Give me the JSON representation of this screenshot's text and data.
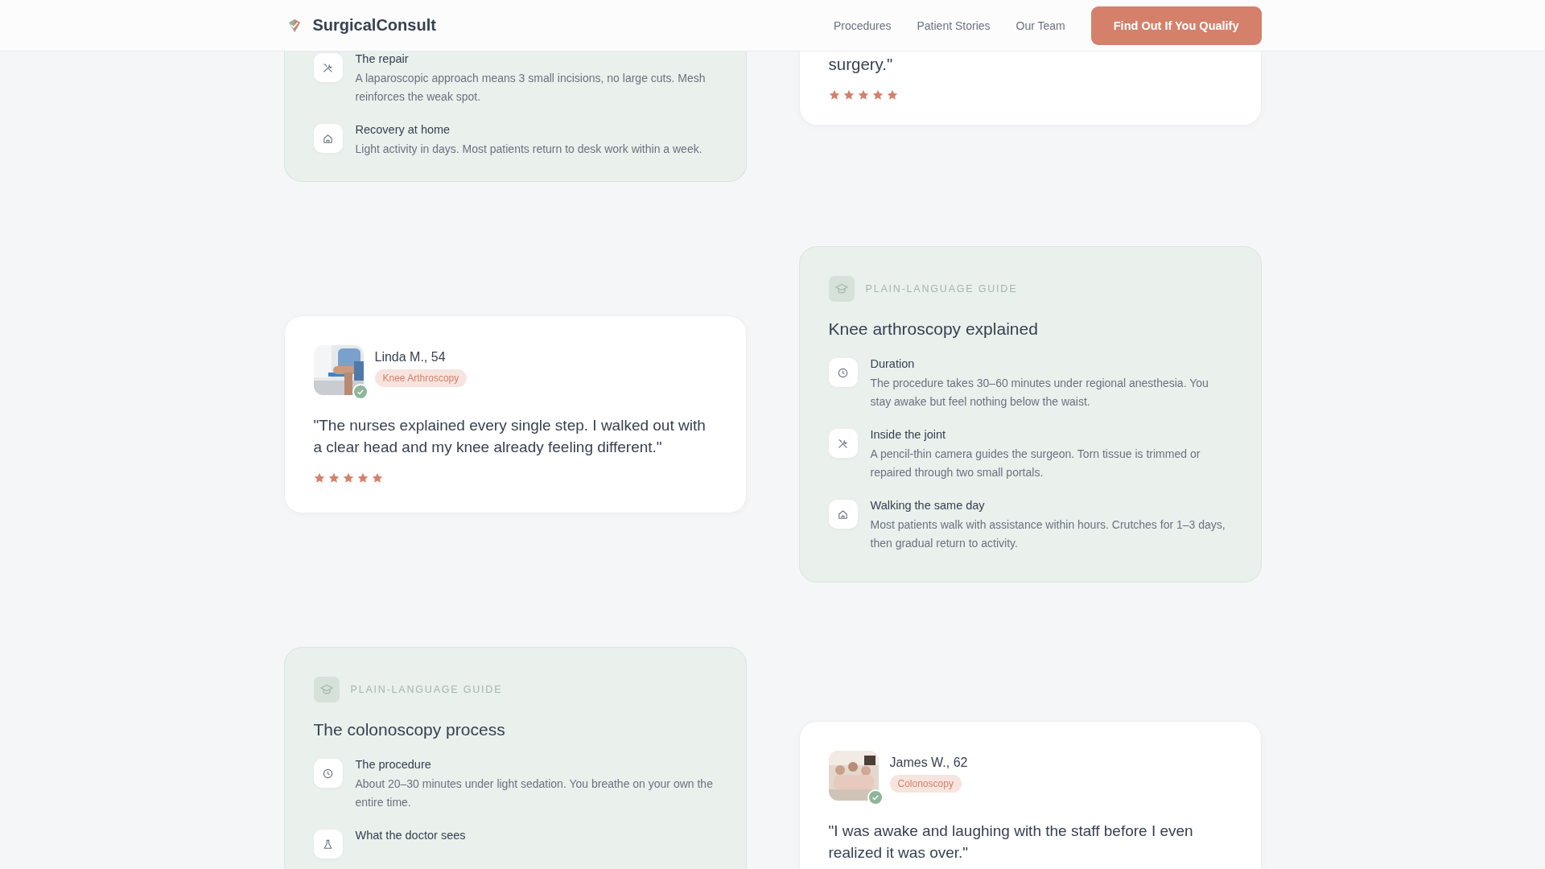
{
  "header": {
    "brand": "SurgicalConsult",
    "nav": [
      "Procedures",
      "Patient Stories",
      "Our Team"
    ],
    "cta": "Find Out If You Qualify"
  },
  "rows": [
    {
      "cards": [
        {
          "kind": "guide",
          "items": [
            {
              "kind": "technique",
              "title": "The repair",
              "text": "A laparoscopic approach means 3 small incisions, no large cuts. Mesh reinforces the weak spot."
            },
            {
              "kind": "recovery",
              "title": "Recovery at home",
              "text": "Light activity in days. Most patients return to desk work within a week."
            }
          ]
        },
        {
          "kind": "testimonial",
          "quote": "surgery.\"",
          "stars": 5
        }
      ]
    },
    {
      "cards": [
        {
          "kind": "testimonial",
          "name": "Linda M., 54",
          "verified": true,
          "tag": "Knee Arthroscopy",
          "quote": "\"The nurses explained every single step. I walked out with a clear head and my knee already feeling different.\"",
          "stars": 5
        },
        {
          "kind": "guide",
          "tag": "PLAIN-LANGUAGE GUIDE",
          "title": "Knee arthroscopy explained",
          "items": [
            {
              "kind": "time",
              "title": "Duration",
              "text": "The procedure takes 30–60 minutes under regional anesthesia. You stay awake but feel nothing below the waist."
            },
            {
              "kind": "technique",
              "title": "Inside the joint",
              "text": "A pencil-thin camera guides the surgeon. Torn tissue is trimmed or repaired through two small portals."
            },
            {
              "kind": "recovery",
              "title": "Walking the same day",
              "text": "Most patients walk with assistance within hours. Crutches for 1–3 days, then gradual return to activity."
            }
          ]
        }
      ]
    },
    {
      "cards": [
        {
          "kind": "guide",
          "tag": "PLAIN-LANGUAGE GUIDE",
          "title": "The colonoscopy process",
          "items": [
            {
              "kind": "time",
              "title": "The procedure",
              "text": "About 20–30 minutes under light sedation. You breathe on your own the entire time."
            },
            {
              "kind": "examination",
              "title": "What the doctor sees"
            }
          ]
        },
        {
          "kind": "testimonial",
          "name": "James W., 62",
          "verified": true,
          "tag": "Colonoscopy",
          "quote": "\"I was awake and laughing with the staff before I even realized it was over.\""
        }
      ]
    }
  ]
}
